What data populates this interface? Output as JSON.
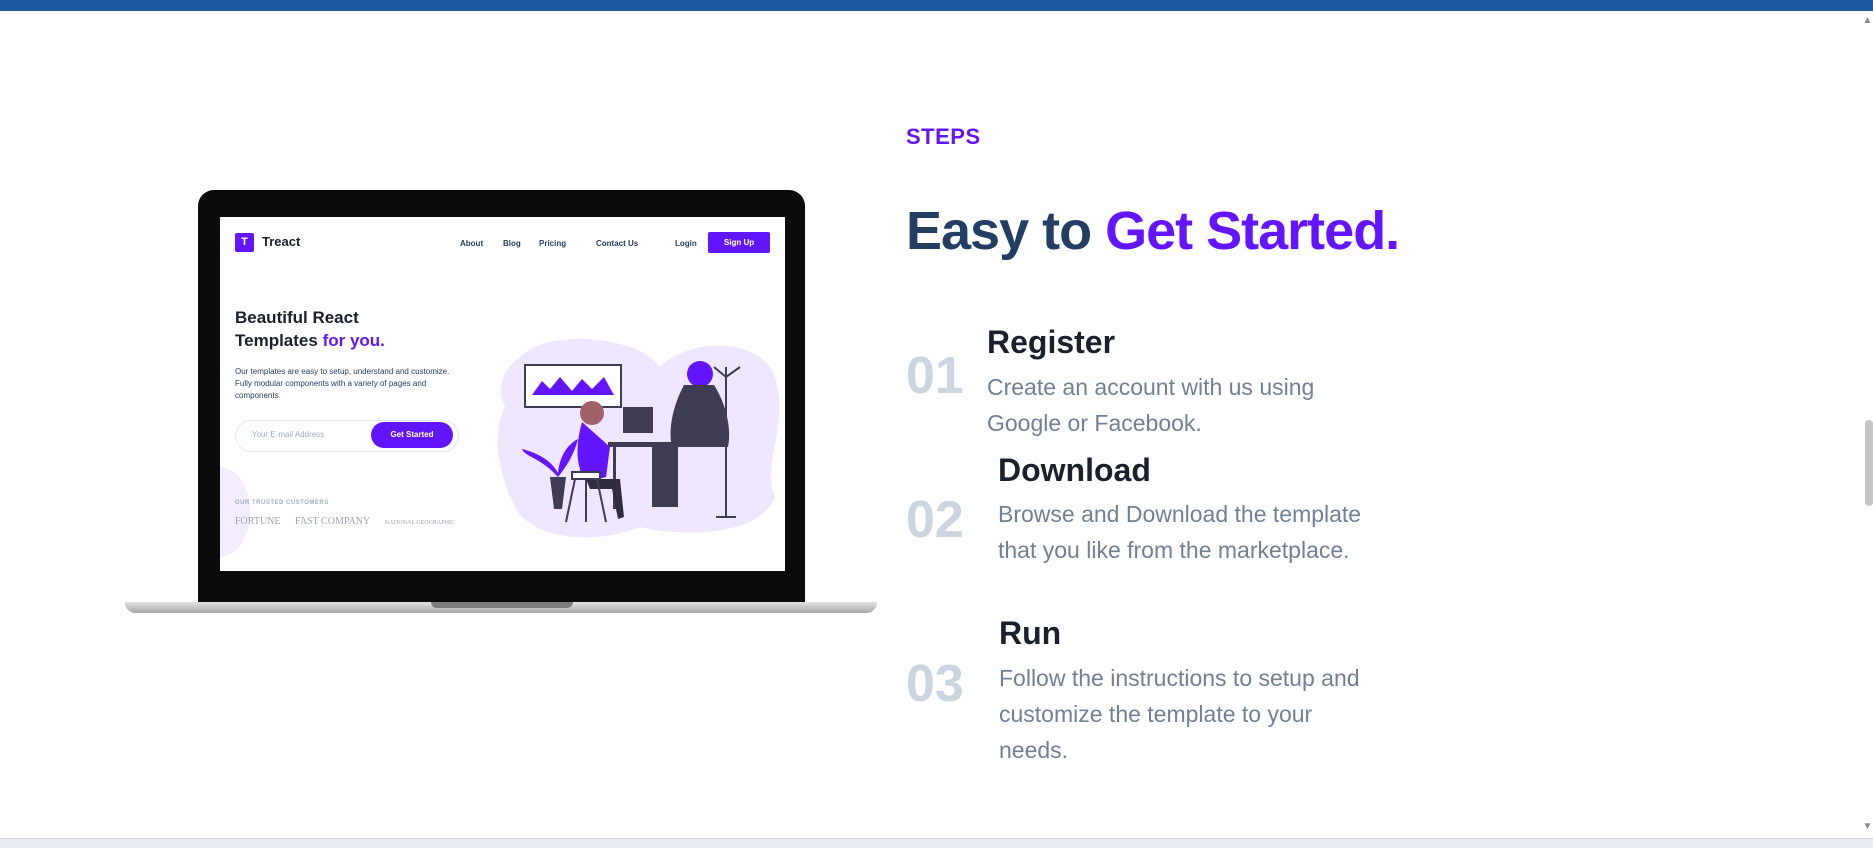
{
  "mockup": {
    "brand_letter": "T",
    "brand_name": "Treact",
    "nav": [
      "About",
      "Blog",
      "Pricing",
      "Contact Us",
      "Login"
    ],
    "signup": "Sign Up",
    "hero_line1": "Beautiful React",
    "hero_line2": "Templates",
    "hero_accent": "for you.",
    "hero_paragraph": "Our templates are easy to setup, understand and customize. Fully modular components with a variety of pages and components.",
    "email_placeholder": "Your E-mail Address",
    "cta": "Get Started",
    "trusted_label": "OUR TRUSTED CUSTOMERS",
    "customer_logos": [
      "FORTUNE",
      "FAST COMPANY",
      "NATIONAL GEOGRAPHIC"
    ]
  },
  "section": {
    "label": "STEPS",
    "heading_start": "Easy to",
    "heading_accent": "Get Started."
  },
  "steps": [
    {
      "number": "01",
      "title": "Register",
      "description": "Create an account with us using Google or Facebook."
    },
    {
      "number": "02",
      "title": "Download",
      "description": "Browse and Download the template that you like from the marketplace."
    },
    {
      "number": "03",
      "title": "Run",
      "description": "Follow the instructions to setup and customize the template to your needs."
    }
  ],
  "colors": {
    "accent": "#6415ff",
    "heading": "#243e63",
    "step_number": "#cbd5e0",
    "body_text": "#718096",
    "browser_bar": "#1c5aa6"
  }
}
